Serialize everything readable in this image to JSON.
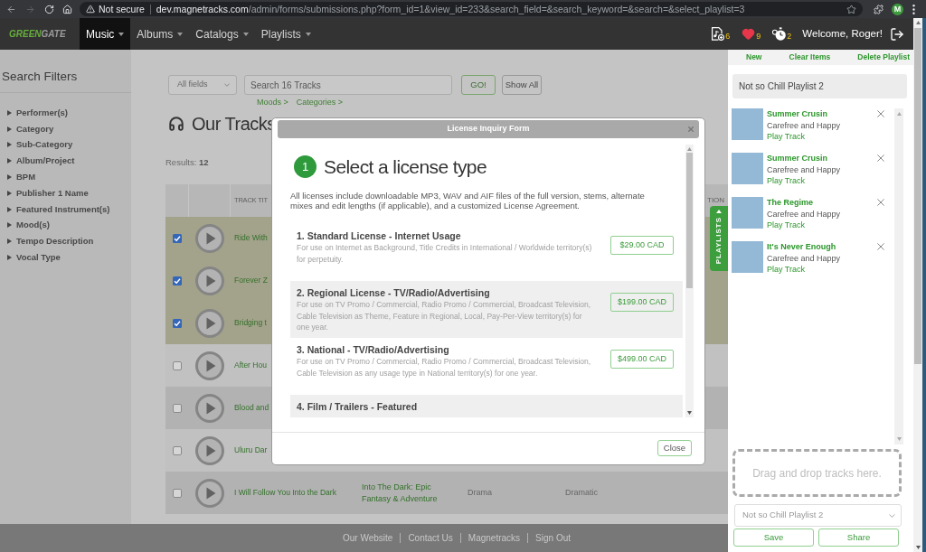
{
  "browser": {
    "security_label": "Not secure",
    "url_host": "dev.magnetracks.com",
    "url_path": "/admin/forms/submissions.php?form_id=1&view_id=233&search_field=&search_keyword=&search=&select_playlist=3",
    "profile_initial": "M"
  },
  "navbar": {
    "logo": [
      "GREEN",
      "GATE"
    ],
    "menu": [
      {
        "label": "Music",
        "selected": true
      },
      {
        "label": "Albums",
        "selected": false
      },
      {
        "label": "Catalogs",
        "selected": false
      },
      {
        "label": "Playlists",
        "selected": false
      }
    ],
    "counters": [
      {
        "kind": "music_file",
        "count": "6"
      },
      {
        "kind": "heart",
        "count": "9"
      },
      {
        "kind": "stopwatch",
        "count": "2"
      }
    ],
    "welcome": "Welcome, Roger!"
  },
  "sidebar": {
    "title": "Search Filters",
    "filters": [
      "Performer(s)",
      "Category",
      "Sub-Category",
      "Album/Project",
      "BPM",
      "Publisher 1 Name",
      "Featured Instrument(s)",
      "Mood(s)",
      "Tempo Description",
      "Vocal Type"
    ]
  },
  "search": {
    "field_select": "All fields",
    "placeholder": "Search 16 Tracks",
    "buttons": [
      "GO!",
      "Show All"
    ],
    "links": [
      "Moods >",
      "Categories >"
    ]
  },
  "heading": "Our Tracks",
  "results": {
    "label": "Results:",
    "count": "12"
  },
  "table": {
    "title_column": "TRACK TIT",
    "column_7": "TION",
    "rows": [
      {
        "checked": true,
        "title": "Ride With"
      },
      {
        "checked": true,
        "title": "Forever Z"
      },
      {
        "checked": true,
        "title": "Bridging t"
      },
      {
        "checked": false,
        "title": "After Hou"
      },
      {
        "checked": false,
        "title": "Blood and"
      },
      {
        "checked": false,
        "title": "Uluru Dar"
      },
      {
        "checked": false,
        "title": "I Will Follow You Into the Dark",
        "album": "Into The Dark: Epic Fantasy & Adventure",
        "category": "Drama",
        "mood": "Dramatic"
      }
    ]
  },
  "footer": {
    "links": [
      "Our Website",
      "Contact Us",
      "Magnetracks",
      "Sign Out"
    ]
  },
  "playlist_tab": {
    "label": "PLAYLISTS"
  },
  "modal": {
    "title": "License Inquiry Form",
    "step": "1",
    "heading": "Select a license type",
    "intro": "All licenses include downloadable MP3, WAV and AIF files of the full version, stems, alternate mixes and edit lengths (if applicable), and a customized License Agreement.",
    "licenses": [
      {
        "title": "1. Standard License - Internet Usage",
        "description": "For use on Internet as Background, Title Credits in International / Worldwide territory(s) for perpetuity.",
        "price": "$29.00 CAD"
      },
      {
        "title": "2. Regional License - TV/Radio/Advertising",
        "description": "For use on TV Promo / Commercial, Radio Promo / Commercial, Broadcast Television, Cable Television as Theme, Feature in Regional, Local, Pay-Per-View territory(s) for one year.",
        "price": "$199.00 CAD"
      },
      {
        "title": "3. National - TV/Radio/Advertising",
        "description": "For use on TV Promo / Commercial, Radio Promo / Commercial, Broadcast Television, Cable Television as any usage type in National territory(s) for one year.",
        "price": "$499.00 CAD"
      },
      {
        "title": "4. Film / Trailers - Featured"
      }
    ],
    "close_button": "Close"
  },
  "playlist_panel": {
    "actions": [
      "New",
      "Clear Items",
      "Delete Playlist"
    ],
    "name": "Not so Chill Playlist 2",
    "tracks": [
      {
        "title": "Summer Crusin",
        "subtitle": "Carefree and Happy",
        "play": "Play Track"
      },
      {
        "title": "Summer Crusin",
        "subtitle": "Carefree and Happy",
        "play": "Play Track"
      },
      {
        "title": "The Regime",
        "subtitle": "Carefree and Happy",
        "play": "Play Track"
      },
      {
        "title": "It's Never Enough",
        "subtitle": "Carefree and Happy",
        "play": "Play Track"
      }
    ],
    "drop_hint": "Drag and drop tracks here.",
    "select": "Not so Chill Playlist 2",
    "buttons": [
      "Save",
      "Share"
    ]
  }
}
